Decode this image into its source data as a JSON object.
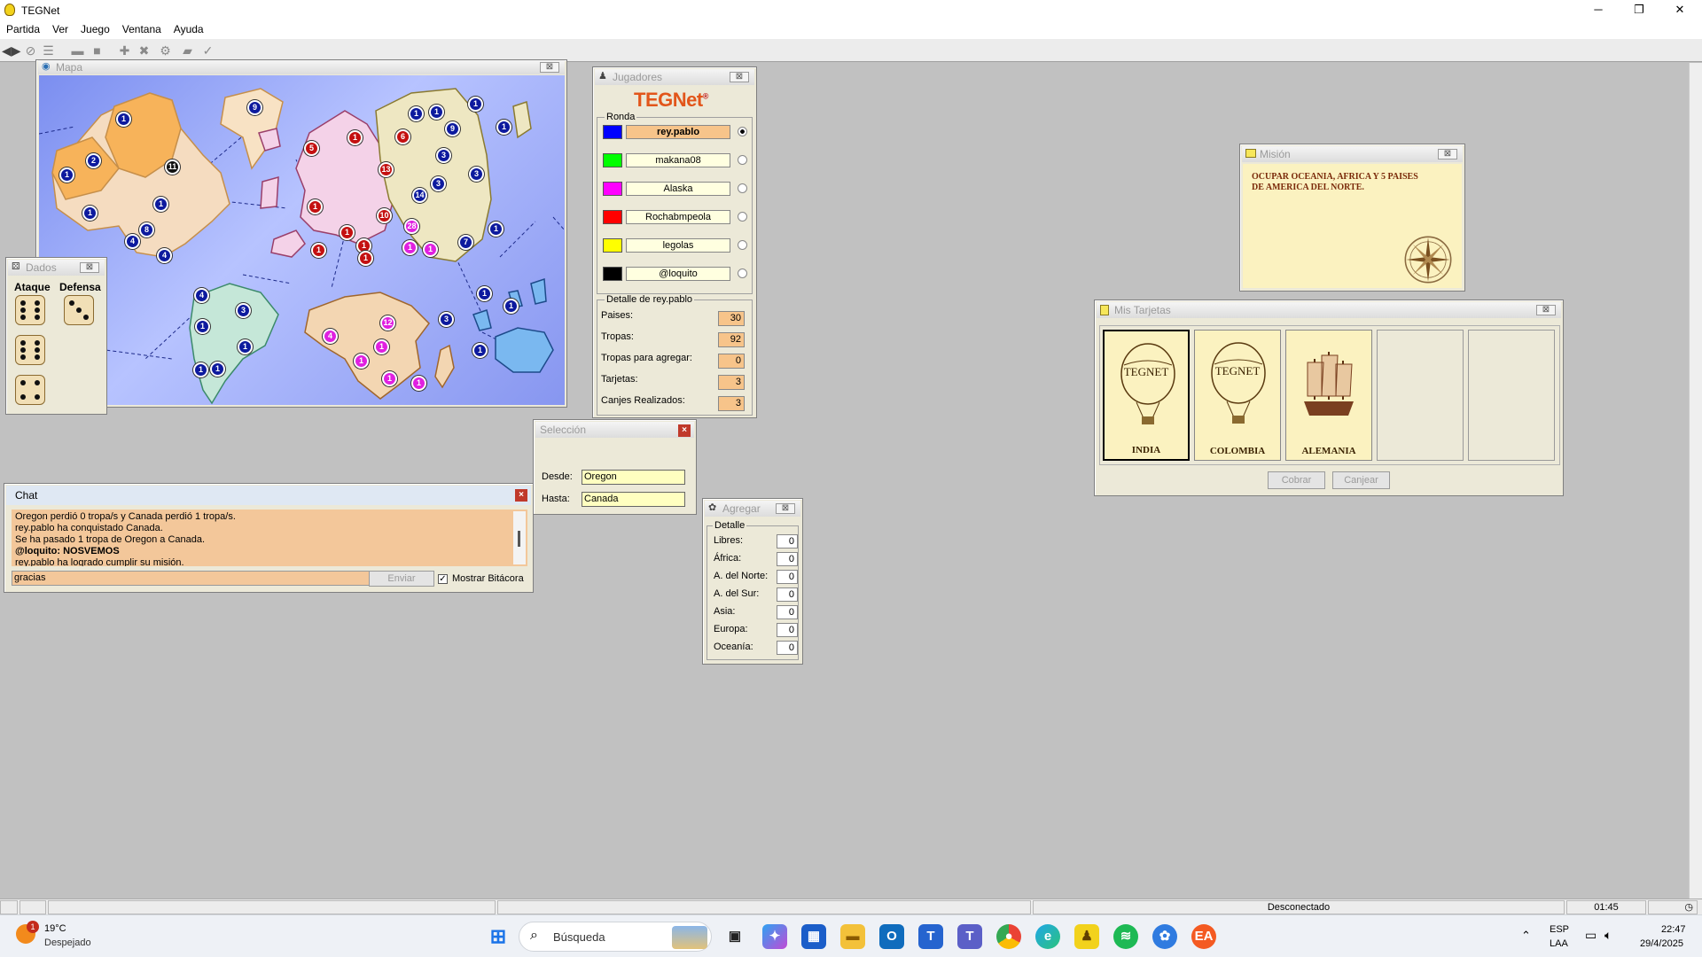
{
  "app": {
    "title": "TEGNet"
  },
  "window_controls": {
    "minimize": "─",
    "maximize": "❐",
    "close": "✕"
  },
  "menu": [
    "Partida",
    "Ver",
    "Juego",
    "Ventana",
    "Ayuda"
  ],
  "toolbar_icons": [
    "connect-icon",
    "start-icon",
    "list-icon",
    "dialog-icon",
    "stop-icon",
    "add-icon",
    "attack-icon",
    "settings-icon",
    "cards-icon",
    "check-icon"
  ],
  "map_window": {
    "title": "Mapa",
    "armies": [
      {
        "n": "1",
        "color": "#0d1a9e"
      },
      {
        "n": "2",
        "color": "#0d1a9e"
      },
      {
        "n": "9",
        "color": "#0d1a9e"
      },
      {
        "n": "1",
        "color": "#0d1a9e"
      },
      {
        "n": "11",
        "color": "#111111"
      },
      {
        "n": "1",
        "color": "#0d1a9e"
      },
      {
        "n": "8",
        "color": "#0d1a9e"
      },
      {
        "n": "1",
        "color": "#0d1a9e"
      },
      {
        "n": "4",
        "color": "#0d1a9e"
      },
      {
        "n": "4",
        "color": "#0d1a9e"
      },
      {
        "n": "4",
        "color": "#0d1a9e"
      },
      {
        "n": "3",
        "color": "#0d1a9e"
      },
      {
        "n": "1",
        "color": "#0d1a9e"
      },
      {
        "n": "1",
        "color": "#0d1a9e"
      },
      {
        "n": "1",
        "color": "#0d1a9e"
      },
      {
        "n": "1",
        "color": "#0d1a9e"
      },
      {
        "n": "5",
        "color": "#c41010"
      },
      {
        "n": "1",
        "color": "#c41010"
      },
      {
        "n": "1",
        "color": "#c41010"
      },
      {
        "n": "13",
        "color": "#c41010"
      },
      {
        "n": "6",
        "color": "#c41010"
      },
      {
        "n": "1",
        "color": "#c41010"
      },
      {
        "n": "10",
        "color": "#c41010"
      },
      {
        "n": "1",
        "color": "#c41010"
      },
      {
        "n": "1",
        "color": "#c41010"
      },
      {
        "n": "1",
        "color": "#c41010"
      },
      {
        "n": "28",
        "color": "#e020e0"
      },
      {
        "n": "1",
        "color": "#e020e0"
      },
      {
        "n": "1",
        "color": "#e020e0"
      },
      {
        "n": "1",
        "color": "#0d1a9e"
      },
      {
        "n": "1",
        "color": "#0d1a9e"
      },
      {
        "n": "9",
        "color": "#0d1a9e"
      },
      {
        "n": "1",
        "color": "#0d1a9e"
      },
      {
        "n": "3",
        "color": "#0d1a9e"
      },
      {
        "n": "3",
        "color": "#0d1a9e"
      },
      {
        "n": "3",
        "color": "#0d1a9e"
      },
      {
        "n": "14",
        "color": "#0d1a9e"
      },
      {
        "n": "7",
        "color": "#0d1a9e"
      },
      {
        "n": "1",
        "color": "#0d1a9e"
      },
      {
        "n": "1",
        "color": "#0d1a9e"
      },
      {
        "n": "1",
        "color": "#0d1a9e"
      },
      {
        "n": "4",
        "color": "#e020e0"
      },
      {
        "n": "12",
        "color": "#e020e0"
      },
      {
        "n": "1",
        "color": "#e020e0"
      },
      {
        "n": "1",
        "color": "#e020e0"
      },
      {
        "n": "1",
        "color": "#e020e0"
      },
      {
        "n": "1",
        "color": "#e020e0"
      },
      {
        "n": "3",
        "color": "#0d1a9e"
      },
      {
        "n": "1",
        "color": "#0d1a9e"
      },
      {
        "n": "1",
        "color": "#0d1a9e"
      }
    ]
  },
  "dados": {
    "title": "Dados",
    "attack_label": "Ataque",
    "defense_label": "Defensa",
    "attack_dice": [
      6,
      6,
      4
    ],
    "defense_dice": [
      3
    ]
  },
  "players": {
    "title": "Jugadores",
    "logo": "TEGNet",
    "logo_mark": "®",
    "round_label": "Ronda",
    "list": [
      {
        "name": "rey.pablo",
        "color": "#0000ff",
        "current": true
      },
      {
        "name": "makana08",
        "color": "#00ff00",
        "current": false
      },
      {
        "name": "Alaska",
        "color": "#ff00ff",
        "current": false
      },
      {
        "name": "Rochabmpeola",
        "color": "#ff0000",
        "current": false
      },
      {
        "name": "legolas",
        "color": "#ffff00",
        "current": false
      },
      {
        "name": "@loquito",
        "color": "#000000",
        "current": false
      }
    ],
    "detail_label": "Detalle de rey.pablo",
    "stats": [
      {
        "label": "Paises:",
        "value": "30"
      },
      {
        "label": "Tropas:",
        "value": "92"
      },
      {
        "label": "Tropas para agregar:",
        "value": "0"
      },
      {
        "label": "Tarjetas:",
        "value": "3"
      },
      {
        "label": "Canjes Realizados:",
        "value": "3"
      }
    ]
  },
  "seleccion": {
    "title": "Selección",
    "desde_label": "Desde:",
    "desde_value": "Oregon",
    "hasta_label": "Hasta:",
    "hasta_value": "Canada"
  },
  "chat": {
    "title": "Chat",
    "lines": [
      {
        "text": "Oregon perdió 0 tropa/s y Canada perdió 1 tropa/s.",
        "bold": false
      },
      {
        "text": "rey.pablo ha conquistado Canada.",
        "bold": false
      },
      {
        "text": "Se ha pasado 1 tropa de Oregon a Canada.",
        "bold": false
      },
      {
        "text": "@loquito: NOSVEMOS",
        "bold": true
      },
      {
        "text": "rey.pablo ha logrado cumplir su misión.",
        "bold": false
      }
    ],
    "input_value": "gracias",
    "send_label": "Enviar",
    "bitacora_label": "Mostrar Bitácora"
  },
  "agregar": {
    "title": "Agregar",
    "detail_label": "Detalle",
    "rows": [
      {
        "label": "Libres:",
        "value": "0"
      },
      {
        "label": "África:",
        "value": "0"
      },
      {
        "label": "A. del Norte:",
        "value": "0"
      },
      {
        "label": "A. del Sur:",
        "value": "0"
      },
      {
        "label": "Asia:",
        "value": "0"
      },
      {
        "label": "Europa:",
        "value": "0"
      },
      {
        "label": "Oceanía:",
        "value": "0"
      }
    ]
  },
  "mision": {
    "title": "Misión",
    "text": "OCUPAR OCEANIA, AFRICA Y 5 PAISES DE AMERICA DEL NORTE."
  },
  "tarjetas": {
    "title": "Mis Tarjetas",
    "cards": [
      {
        "country": "INDIA",
        "symbol": "balloon",
        "brand": "TEGNET"
      },
      {
        "country": "COLOMBIA",
        "symbol": "balloon",
        "brand": "TEGNET"
      },
      {
        "country": "ALEMANIA",
        "symbol": "ship",
        "brand": ""
      }
    ],
    "cobrar_label": "Cobrar",
    "canjear_label": "Canjear"
  },
  "statusbar": {
    "connection": "Desconectado",
    "time": "01:45"
  },
  "taskbar": {
    "weather_temp": "19°C",
    "weather_desc": "Despejado",
    "weather_badge": "1",
    "search_placeholder": "Búsqueda",
    "lang_top": "ESP",
    "lang_bottom": "LAA",
    "clock_time": "22:47",
    "clock_date": "29/4/2025"
  }
}
